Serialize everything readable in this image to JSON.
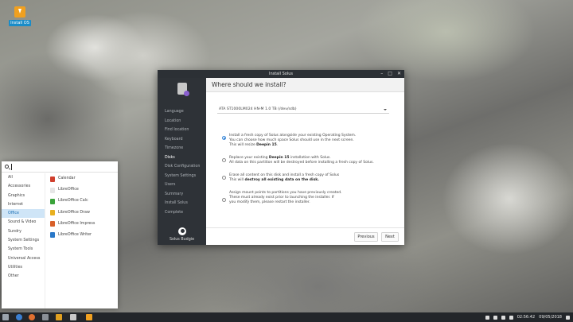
{
  "desktop": {
    "install_icon_label": "Install OS"
  },
  "window": {
    "title": "Install Solus",
    "heading": "Where should we install?",
    "sidebar": {
      "items": [
        {
          "label": "Language",
          "active": false
        },
        {
          "label": "Location",
          "active": false
        },
        {
          "label": "Find location",
          "active": false
        },
        {
          "label": "Keyboard",
          "active": false
        },
        {
          "label": "Timezone",
          "active": false
        },
        {
          "label": "Disks",
          "active": true
        },
        {
          "label": "Disk Configuration",
          "active": false
        },
        {
          "label": "System Settings",
          "active": false
        },
        {
          "label": "Users",
          "active": false
        },
        {
          "label": "Summary",
          "active": false
        },
        {
          "label": "Install Solus",
          "active": false
        },
        {
          "label": "Complete",
          "active": false
        }
      ],
      "brand": "Solus Budgie"
    },
    "disk_select": {
      "value": "ATA ST1000LM024 HN-M 1.0 TB (/dev/sdb)"
    },
    "options": {
      "o1": {
        "line1": "Install a fresh copy of Solus alongside your existing Operating System.",
        "line2": "You can choose how much space Solus should use in the next screen.",
        "line3a": "This will resize ",
        "line3b": "Deepin 15",
        "line3c": ".",
        "checked": true
      },
      "o2": {
        "line1a": "Replace your existing ",
        "line1b": "Deepin 15",
        "line1c": " installation with Solus.",
        "line2": "All data on this partition will be destroyed before installing a fresh copy of Solus.",
        "checked": false
      },
      "o3": {
        "line1": "Erase all content on this disk and install a fresh copy of Solus",
        "line2a": "This will ",
        "line2b": "destroy all existing data on the disk.",
        "checked": false
      },
      "o4": {
        "line1": "Assign mount points to partitions you have previously created.",
        "line2": "These must already exist prior to launching the installer. If",
        "line3": "you modify them, please restart the installer.",
        "checked": false
      }
    },
    "buttons": {
      "previous": "Previous",
      "next": "Next"
    }
  },
  "menu": {
    "search_value": "",
    "categories": [
      "All",
      "Accessories",
      "Graphics",
      "Internet",
      "Office",
      "Sound & Video",
      "Sundry",
      "System Settings",
      "System Tools",
      "Universal Access",
      "Utilities",
      "Other"
    ],
    "active_category": "Office",
    "apps": [
      {
        "label": "Calendar",
        "color": "#d0402e"
      },
      {
        "label": "LibreOffice",
        "color": "#e6e6e6"
      },
      {
        "label": "LibreOffice Calc",
        "color": "#3aa33a"
      },
      {
        "label": "LibreOffice Draw",
        "color": "#e8b020"
      },
      {
        "label": "LibreOffice Impress",
        "color": "#d8602a"
      },
      {
        "label": "LibreOffice Writer",
        "color": "#2a78c8"
      }
    ]
  },
  "panel": {
    "time": "02:56:42",
    "date": "09/05/2018"
  },
  "colors": {
    "accent": "#3b88d8",
    "sidebar_bg": "#2e3237",
    "panel_bg": "#23262a"
  }
}
